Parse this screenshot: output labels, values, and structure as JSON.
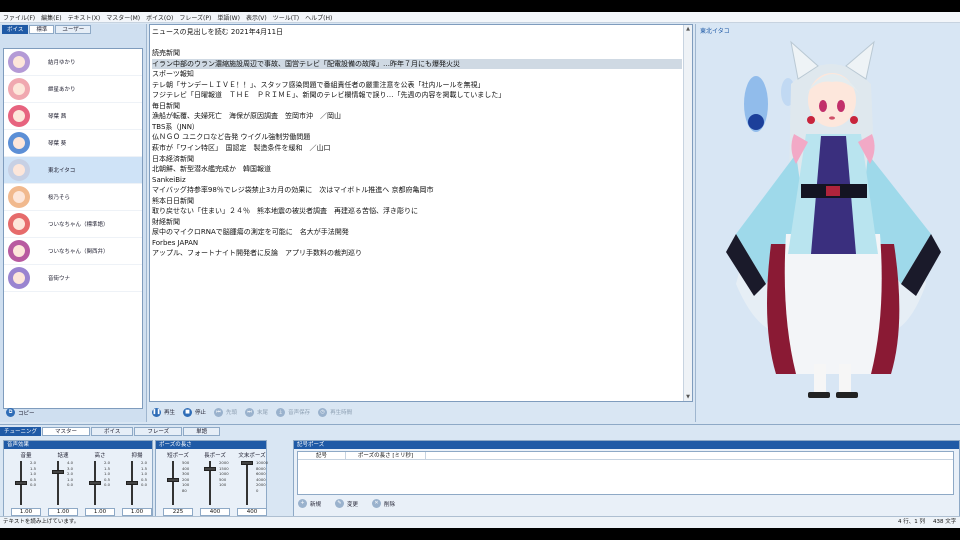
{
  "menu": [
    "ファイル(F)",
    "編集(E)",
    "テキスト(X)",
    "マスター(M)",
    "ボイス(O)",
    "フレーズ(P)",
    "単語(W)",
    "表示(V)",
    "ツール(T)",
    "ヘルプ(H)"
  ],
  "voice_panel": {
    "tab_tag": "ボイス",
    "tabs": [
      "標準",
      "ユーザー"
    ],
    "active_tab": 0,
    "voices": [
      "結月ゆかり",
      "紲星あかり",
      "琴葉 茜",
      "琴葉 葵",
      "東北イタコ",
      "桜乃そら",
      "ついなちゃん（標準語）",
      "ついなちゃん（関西弁）",
      "音街ウナ"
    ],
    "selected_index": 4,
    "avatar_colors": [
      "#b49ad6",
      "#f0a8b0",
      "#e7637f",
      "#5c8fd6",
      "#c7d0e4",
      "#f1b98e",
      "#e66b6b",
      "#b85aa0",
      "#9a84d0"
    ],
    "copy_label": "コピー"
  },
  "editor": {
    "lines": [
      "ニュースの見出しを読む 2021年4月11日",
      "",
      "読売新聞",
      "イラン中部のウラン濃縮施設周辺で事故、国営テレビ「配電設備の故障」…昨年７月にも爆発火災",
      "スポーツ報知",
      "テレ朝「サンデーＬＩＶＥ！！」、スタッフ感染問題で番組責任者の厳重注意を公表「社内ルールを無視」",
      "フジテレビ「日曜報道　ＴＨＥ　ＰＲＩＭＥ」、新聞のテレビ欄情報で誤り…「先週の内容を掲載していました」",
      "毎日新聞",
      "漁船が転覆、夫婦死亡　海保が原因調査　笠岡市沖　／岡山",
      "TBS系（JNN）",
      "仏ＮＧＯ ユニクロなど告発 ウイグル強制労働問題",
      "萩市が「ワイン特区」　国認定　製造条件を緩和　／山口",
      "日本経済新聞",
      "北朝鮮、新型潜水艦完成か　韓国報道",
      "SankeiBiz",
      "マイバッグ持参率98％でレジ袋禁止3カ月の効果に　次はマイボトル推進へ 京都府亀岡市",
      "熊本日日新聞",
      "取り戻せない「住まい」２４％　熊本地震の被災者調査　再建巡る苦悩、浮き彫りに",
      "財経新聞",
      "尿中のマイクロRNAで脳腫瘍の測定を可能に　名大が手法開発",
      "Forbes JAPAN",
      "アップル、フォートナイト開発者に反論　アプリ手数料の裁判巡り"
    ],
    "highlight_index": 3
  },
  "playback": [
    {
      "label": "再生",
      "enabled": true
    },
    {
      "label": "停止",
      "enabled": true
    },
    {
      "label": "先頭",
      "enabled": false
    },
    {
      "label": "末尾",
      "enabled": false
    },
    {
      "label": "音声保存",
      "enabled": false
    },
    {
      "label": "再生時間",
      "enabled": false
    }
  ],
  "character": {
    "name": "東北イタコ"
  },
  "bottom": {
    "tab_tag": "チューニング",
    "tabs": [
      "マスター",
      "ボイス",
      "フレーズ",
      "単語"
    ],
    "active_tab": 0,
    "effects_title": "音声効果",
    "pause_title": "ポーズの長さ",
    "effects": [
      {
        "label": "音量",
        "value": "1.00",
        "fraction": 0.5,
        "ticks": [
          "2.0",
          "1.5",
          "1.0",
          "0.5",
          "0.0"
        ]
      },
      {
        "label": "話速",
        "value": "1.00",
        "fraction": 0.25,
        "ticks": [
          "4.0",
          "3.0",
          "2.0",
          "1.0",
          "0.0"
        ]
      },
      {
        "label": "高さ",
        "value": "1.00",
        "fraction": 0.5,
        "ticks": [
          "2.0",
          "1.5",
          "1.0",
          "0.5",
          "0.0"
        ]
      },
      {
        "label": "抑揚",
        "value": "1.00",
        "fraction": 0.5,
        "ticks": [
          "2.0",
          "1.5",
          "1.0",
          "0.5",
          "0.0"
        ]
      }
    ],
    "pauses": [
      {
        "label": "短ポーズ",
        "value": "225",
        "fraction": 0.43,
        "ticks": [
          "500",
          "400",
          "300",
          "200",
          "100",
          "80"
        ]
      },
      {
        "label": "長ポーズ",
        "value": "400",
        "fraction": 0.18,
        "ticks": [
          "2000",
          "1500",
          "1000",
          "500",
          "100"
        ]
      },
      {
        "label": "文末ポーズ",
        "value": "400",
        "fraction": 0.04,
        "ticks": [
          "10000",
          "8000",
          "6000",
          "4000",
          "2000",
          "0"
        ]
      }
    ],
    "kigo_title": "記号ポーズ",
    "kigo_columns": [
      "記号",
      "ポーズの長さ [ミリ秒]"
    ],
    "kigo_buttons": [
      "新規",
      "変更",
      "削除"
    ]
  },
  "status": {
    "message": "テキストを読み上げています。",
    "position": "4 行、1 列",
    "chars": "438 文字"
  },
  "colors": {
    "accent": "#1f5aa6",
    "panel": "#d9e6f3",
    "highlight": "#cfd9e3"
  }
}
